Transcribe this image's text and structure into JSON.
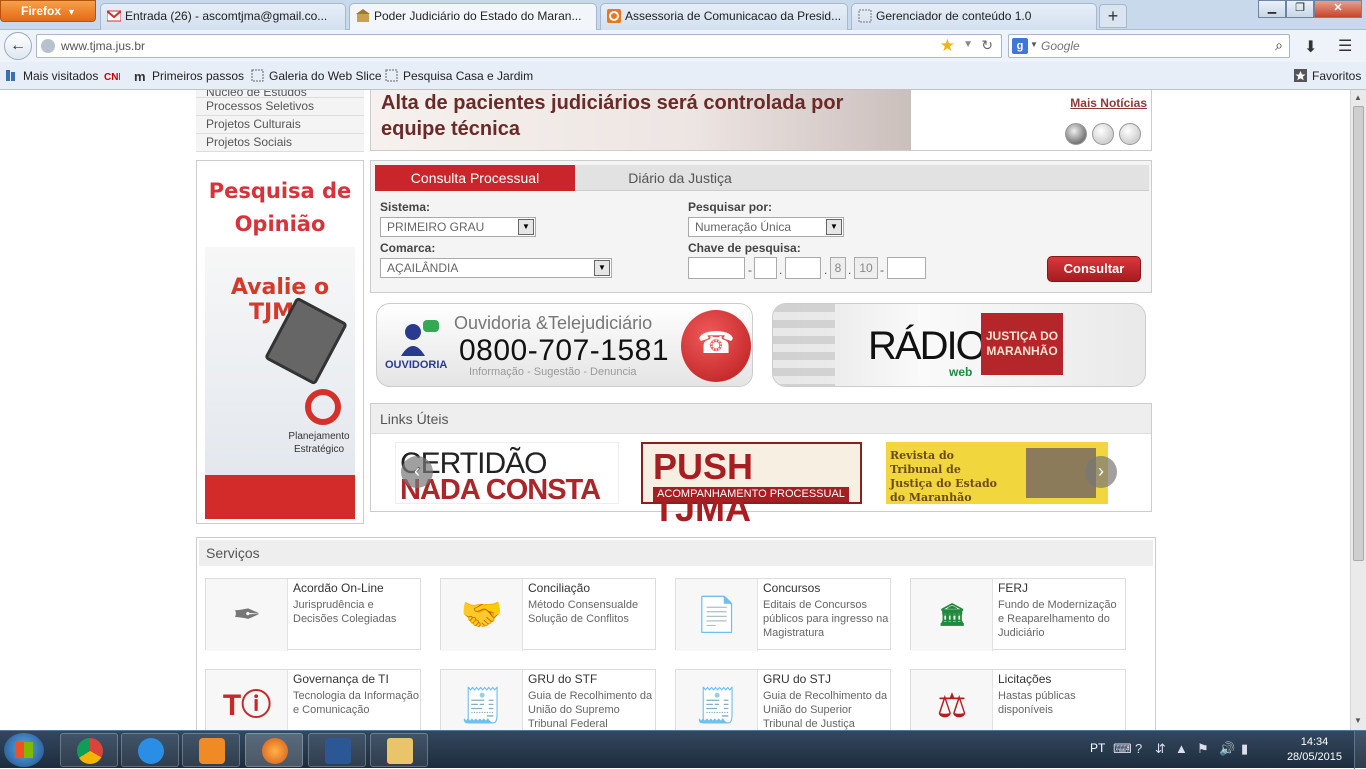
{
  "browser": {
    "menu_label": "Firefox",
    "tabs": [
      {
        "label": "Entrada (26) - ascomtjma@gmail.co...",
        "icon": "gmail-icon"
      },
      {
        "label": "Poder Judiciário do Estado do Maran...",
        "icon": "tjma-icon",
        "active": true
      },
      {
        "label": "Assessoria de Comunicacao da Presid...",
        "icon": "office-icon"
      },
      {
        "label": "Gerenciador de conteúdo 1.0",
        "icon": "blank-page-icon"
      }
    ],
    "new_tab": "+",
    "url": "www.tjma.jus.br",
    "search_placeholder": "Google",
    "bookmarks": [
      "Mais visitados",
      "Primeiros passos",
      "Galeria do Web Slice",
      "Pesquisa Casa e Jardim"
    ],
    "favorites": "Favoritos"
  },
  "sidebar_menu": [
    "Núcleo de Estudos",
    "Processos Seletivos",
    "Projetos Culturais",
    "Projetos Sociais"
  ],
  "news": {
    "headline": "Alta de pacientes judiciários será controlada por equipe técnica",
    "more_link": "Mais Notícias"
  },
  "survey": {
    "title": "Pesquisa de Opinião",
    "subtitle": "Avalie o TJMA",
    "logo_text": "Planejamento Estratégico"
  },
  "consulta": {
    "tab_active": "Consulta Processual",
    "tab_inactive": "Diário da Justiça",
    "sistema_label": "Sistema:",
    "sistema_value": "PRIMEIRO GRAU",
    "comarca_label": "Comarca:",
    "comarca_value": "AÇAILÂNDIA",
    "pesquisar_label": "Pesquisar por:",
    "pesquisar_value": "Numeração Única",
    "chave_label": "Chave de pesquisa:",
    "chave_fixed_1": "8",
    "chave_fixed_2": "10",
    "button": "Consultar"
  },
  "banners": {
    "ouvidoria_title": "Ouvidoria &Telejudiciário",
    "ouvidoria_phone": "0800-707-1581",
    "ouvidoria_sub": "Informação - Sugestão - Denuncia",
    "ouvidoria_logo": "OUVIDORIA",
    "radio_word": "RÁDIO",
    "radio_web": "web",
    "radio_badge": "JUSTIÇA DO MARANHÃO"
  },
  "links_uteis": {
    "title": "Links Úteis",
    "certidao_1": "CERTIDÃO",
    "certidao_2": "NADA CONSTA",
    "push_1": "PUSH TJMA",
    "push_2": "ACOMPANHAMENTO PROCESSUAL",
    "revista": "Revista do Tribunal de Justiça do Estado do Maranhão"
  },
  "servicos": {
    "title": "Serviços",
    "items": [
      {
        "title": "Acordão On-Line",
        "desc": "Jurisprudência e Decisões Colegiadas"
      },
      {
        "title": "Conciliação",
        "desc": "Método Consensualde Solução de Conflitos"
      },
      {
        "title": "Concursos",
        "desc": "Editais de Concursos públicos para ingresso na Magistratura"
      },
      {
        "title": "FERJ",
        "desc": "Fundo de Modernização e Reaparelhamento do Judiciário"
      },
      {
        "title": "Governança de TI",
        "desc": "Tecnologia da Informação e Comunicação"
      },
      {
        "title": "GRU do STF",
        "desc": "Guia de Recolhimento da União do Supremo Tribunal Federal"
      },
      {
        "title": "GRU do STJ",
        "desc": "Guia de Recolhimento da União do Superior Tribunal de Justiça"
      },
      {
        "title": "Licitações",
        "desc": "Hastas públicas disponíveis"
      }
    ]
  },
  "taskbar": {
    "lang": "PT",
    "time": "14:34",
    "date": "28/05/2015"
  }
}
